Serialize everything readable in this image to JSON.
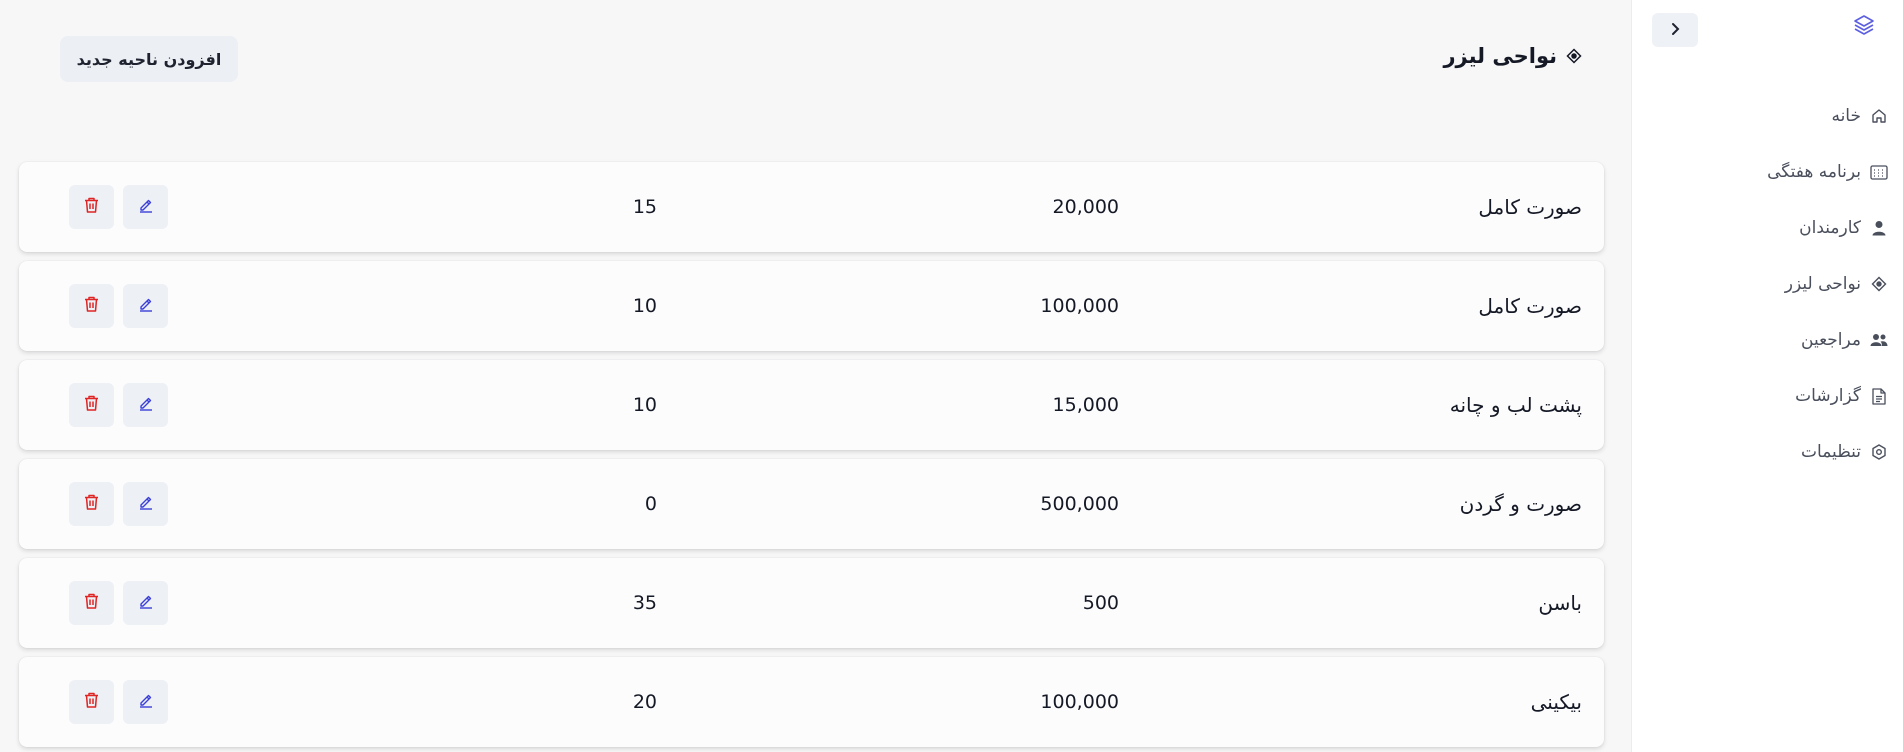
{
  "sidebar": {
    "items": [
      {
        "label": "خانه",
        "icon": "home-icon"
      },
      {
        "label": "برنامه هفتگی",
        "icon": "calendar-icon"
      },
      {
        "label": "کارمندان",
        "icon": "user-icon"
      },
      {
        "label": "نواحی لیزر",
        "icon": "target-icon"
      },
      {
        "label": "مراجعین",
        "icon": "users-icon"
      },
      {
        "label": "گزارشات",
        "icon": "document-icon"
      },
      {
        "label": "تنظیمات",
        "icon": "settings-icon"
      }
    ]
  },
  "header": {
    "title": "نواحی لیزر",
    "add_button": "افزودن ناحیه جدید"
  },
  "areas": [
    {
      "name": "صورت کامل",
      "price": "20,000",
      "duration": "15"
    },
    {
      "name": "صورت کامل",
      "price": "100,000",
      "duration": "10"
    },
    {
      "name": "پشت لب و چانه",
      "price": "15,000",
      "duration": "10"
    },
    {
      "name": "صورت و گردن",
      "price": "500,000",
      "duration": "0"
    },
    {
      "name": "باسن",
      "price": "500",
      "duration": "35"
    },
    {
      "name": "بیکینی",
      "price": "100,000",
      "duration": "20"
    }
  ],
  "colors": {
    "accent": "#3b3fd8",
    "danger": "#e02424",
    "button_bg": "#edf0f4"
  }
}
